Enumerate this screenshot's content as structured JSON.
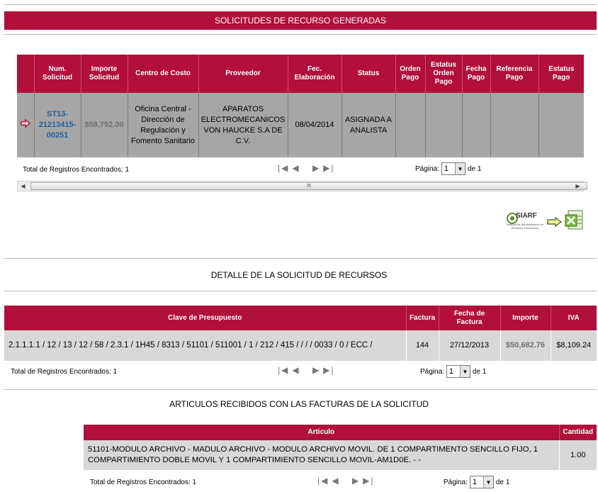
{
  "section1": {
    "title": "SOLICITUDES DE RECURSO GENERADAS"
  },
  "table1": {
    "headers": {
      "num_solicitud": "Num. Solicitud",
      "importe": "Importe Solicitud",
      "centro": "Centro de Costo",
      "proveedor": "Proveedor",
      "fec": "Fec. Elaboración",
      "status": "Status",
      "orden_pago": "Orden Pago",
      "estatus_orden": "Estatus Orden Pago",
      "fecha_pago": "Fecha Pago",
      "referencia": "Referencia Pago",
      "estatus_pago": "Estatus Pago"
    },
    "row": {
      "num_solicitud": "ST13-21213415-00251",
      "importe": "$58,792.00",
      "centro": "Oficina Central - Dirección de Regulación y Fomento Sanitario",
      "proveedor": "APARATOS ELECTROMECANICOS VON HAUCKE S.A DE C.V.",
      "fec": "08/04/2014",
      "status": "ASIGNADA A ANALISTA",
      "orden_pago": "",
      "estatus_orden": "",
      "fecha_pago": "",
      "referencia": "",
      "estatus_pago": ""
    },
    "pager": {
      "total": "Total de Registros Encontrados: 1",
      "page_label": "Página:",
      "page_value": "1",
      "of": "de 1"
    },
    "scroll_thumb_label": "III"
  },
  "logo": {
    "text": "SIARF",
    "subtitle": "Sistema de Administración de Recursos Financieros"
  },
  "section2": {
    "title": "DETALLE DE LA SOLICITUD DE RECURSOS"
  },
  "table2": {
    "headers": {
      "clave": "Clave de Presupuesto",
      "factura": "Factura",
      "fecha": "Fecha de Factura",
      "importe": "Importe",
      "iva": "IVA"
    },
    "row": {
      "clave": "2.1.1.1.1 / 12 / 13 / 12 / 58 / 2.3.1 / 1H45 / 8313 / 51101 / 511001 / 1 / 212 / 415 / / / / 0033 / 0 / ECC /",
      "factura": "144",
      "fecha": "27/12/2013",
      "importe": "$50,682.76",
      "iva": "$8,109.24"
    },
    "pager": {
      "total": "Total de Registros Encontrados: 1",
      "page_label": "Página:",
      "page_value": "1",
      "of": "de 1"
    }
  },
  "section3": {
    "title": "ARTICULOS RECIBIDOS CON LAS FACTURAS DE LA SOLICITUD"
  },
  "table3": {
    "headers": {
      "articulo": "Articulo",
      "cantidad": "Cantidad"
    },
    "row": {
      "articulo": "51101-MODULO ARCHIVO - MADULO ARCHIVO - MODULO ARCHIVO MOVIL. DE 1 COMPARTIMENTO SENCILLO FIJO, 1 COMPARTIMIENTO DOBLE MOVIL Y 1 COMPARTIMIENTO SENCILLO MOVIL-AM1D0E. - -",
      "cantidad": "1.00"
    },
    "pager": {
      "total": "Total de Registros Encontrados: 1",
      "page_label": "Página:",
      "page_value": "1",
      "of": "de 1"
    }
  },
  "colors": {
    "header_bg": "#b0103a",
    "link": "#1f5f9c"
  }
}
